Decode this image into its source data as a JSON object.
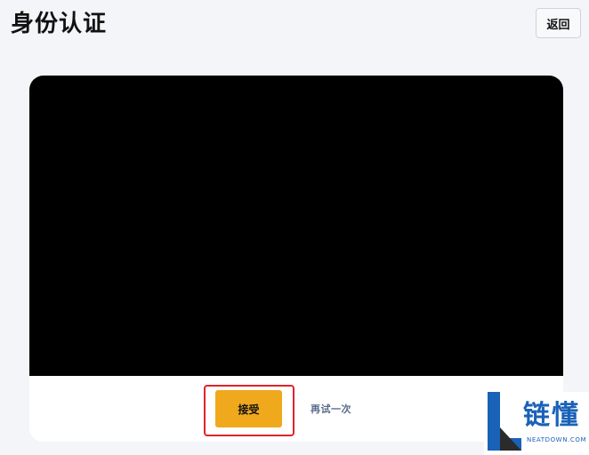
{
  "header": {
    "title": "身份认证",
    "back_label": "返回"
  },
  "capture": {
    "accept_label": "接受",
    "retry_label": "再试一次"
  },
  "watermark": {
    "brand": "链懂",
    "domain": "NEATDOWN.COM"
  },
  "colors": {
    "accent": "#f0a81d",
    "highlight": "#e0232b",
    "background": "#f4f5f9",
    "brand": "#1a62b8"
  }
}
